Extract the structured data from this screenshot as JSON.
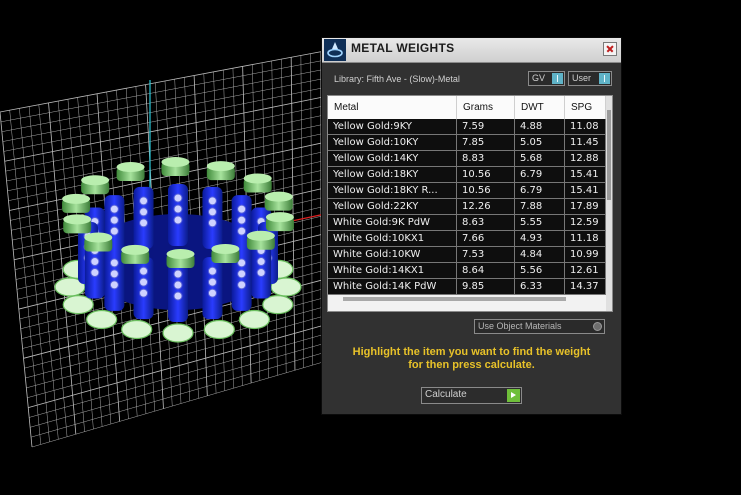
{
  "app": {
    "title": "METAL WEIGHTS"
  },
  "library": {
    "label": "Library: Fifth Ave - (Slow)-Metal"
  },
  "toggles": {
    "gv": "GV",
    "user": "User"
  },
  "table": {
    "columns": [
      "Metal",
      "Grams",
      "DWT",
      "SPG"
    ],
    "rows": [
      [
        "Yellow Gold:9KY",
        "7.59",
        "4.88",
        "11.08"
      ],
      [
        "Yellow Gold:10KY",
        "7.85",
        "5.05",
        "11.45"
      ],
      [
        "Yellow Gold:14KY",
        "8.83",
        "5.68",
        "12.88"
      ],
      [
        "Yellow Gold:18KY",
        "10.56",
        "6.79",
        "15.41"
      ],
      [
        "Yellow Gold:18KY R...",
        "10.56",
        "6.79",
        "15.41"
      ],
      [
        "Yellow Gold:22KY",
        "12.26",
        "7.88",
        "17.89"
      ],
      [
        "White Gold:9K PdW",
        "8.63",
        "5.55",
        "12.59"
      ],
      [
        "White Gold:10KX1",
        "7.66",
        "4.93",
        "11.18"
      ],
      [
        "White Gold:10KW",
        "7.53",
        "4.84",
        "10.99"
      ],
      [
        "White Gold:14KX1",
        "8.64",
        "5.56",
        "12.61"
      ],
      [
        "White Gold:14K PdW",
        "9.85",
        "6.33",
        "14.37"
      ]
    ]
  },
  "object_materials": {
    "label": "Use Object Materials"
  },
  "instructions": {
    "line1": "Highlight the item you want to find the weight",
    "line2": "for then press calculate."
  },
  "calculate": {
    "label": "Calculate"
  },
  "colors": {
    "panel_bg": "#313131",
    "accent_yellow": "#e8c229",
    "toggle_knob": "#5fb3c7",
    "calc_arrow": "#6fbf3a",
    "grid": "#c8c8c8"
  },
  "icons": {
    "logo": "ring-logo-icon",
    "close": "close-icon",
    "toggle": "toggle-switch-icon",
    "radio": "radio-icon",
    "arrow": "play-arrow-icon"
  }
}
